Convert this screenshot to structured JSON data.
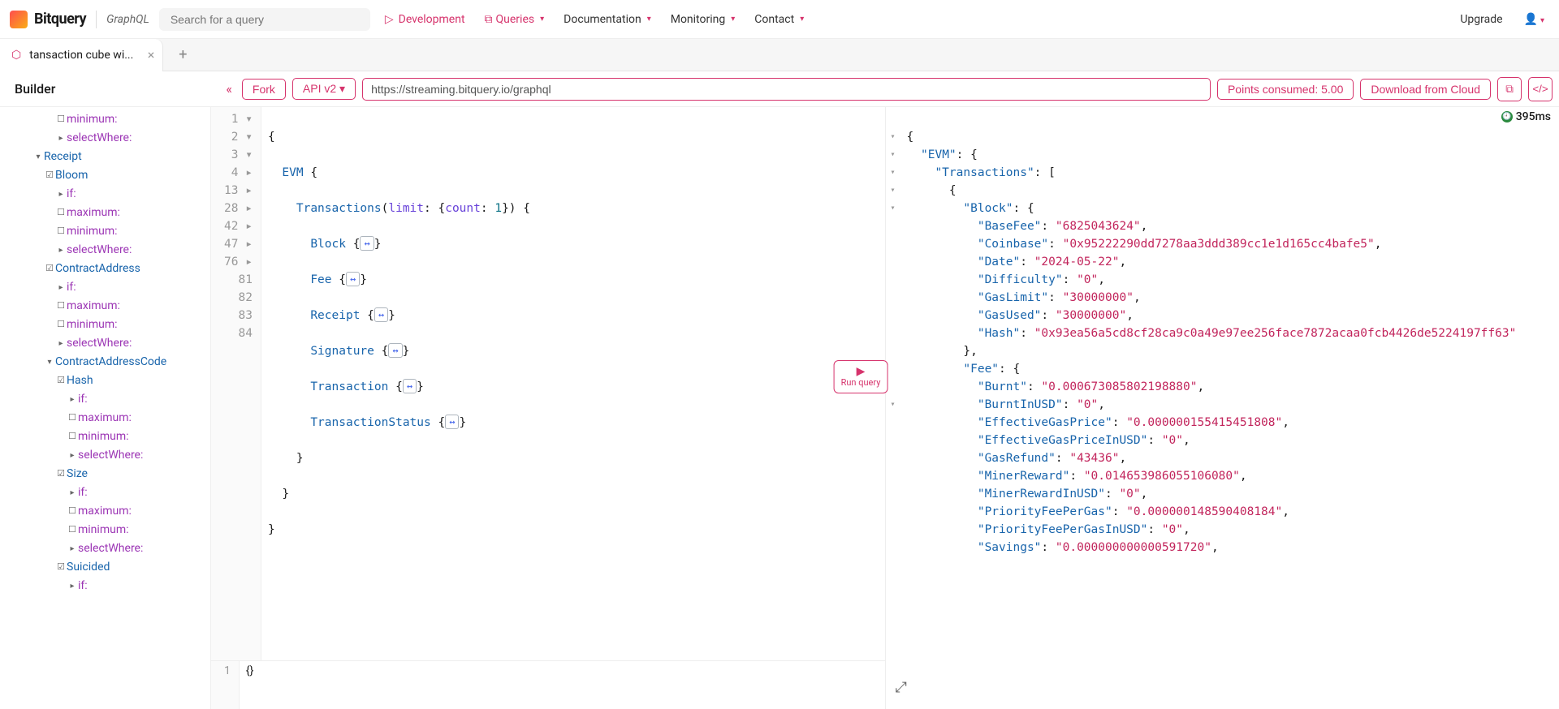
{
  "nav": {
    "brand": "Bitquery",
    "graphql": "GraphQL",
    "search_placeholder": "Search for a query",
    "development": "Development",
    "queries": "Queries",
    "documentation": "Documentation",
    "monitoring": "Monitoring",
    "contact": "Contact",
    "upgrade": "Upgrade"
  },
  "tab": {
    "title": "tansaction cube wi...",
    "close": "×",
    "add": "+"
  },
  "toolbar": {
    "builder": "Builder",
    "collapse": "«",
    "fork": "Fork",
    "api_version": "API v2",
    "url": "https://streaming.bitquery.io/graphql",
    "points": "Points consumed: 5.00",
    "download": "Download from Cloud"
  },
  "sidebar": {
    "minimum": "minimum:",
    "maximum": "maximum:",
    "selectWhere": "selectWhere:",
    "if": "if:",
    "receipt": "Receipt",
    "bloom": "Bloom",
    "contractAddress": "ContractAddress",
    "contractAddressCode": "ContractAddressCode",
    "hash": "Hash",
    "size": "Size",
    "suicided": "Suicided"
  },
  "editor": {
    "gutter": [
      "1",
      "2",
      "3",
      "4",
      "13",
      "28",
      "42",
      "47",
      "76",
      "81",
      "82",
      "83",
      "84"
    ],
    "line1": "{",
    "line2_a": "EVM",
    "line2_b": " {",
    "line3_a": "Transactions",
    "line3_b": "(",
    "line3_c": "limit",
    "line3_d": ": {",
    "line3_e": "count",
    "line3_f": ": ",
    "line3_g": "1",
    "line3_h": "}) {",
    "line4_a": "Block",
    "line4_b": " {",
    "fold": "↔",
    "line4_c": "}",
    "line5_a": "Fee",
    "line6_a": "Receipt",
    "line7_a": "Signature",
    "line8_a": "Transaction",
    "line9_a": "TransactionStatus",
    "line10": "    }",
    "line11": "  }",
    "line12": "}",
    "vars_gutter": "1",
    "vars_body": "{}"
  },
  "results": {
    "timing": "395ms",
    "body_keys": {
      "evm": "\"EVM\"",
      "transactions": "\"Transactions\"",
      "block": "\"Block\"",
      "basefee": "\"BaseFee\"",
      "coinbase": "\"Coinbase\"",
      "date": "\"Date\"",
      "difficulty": "\"Difficulty\"",
      "gaslimit": "\"GasLimit\"",
      "gasused": "\"GasUsed\"",
      "hash": "\"Hash\"",
      "fee": "\"Fee\"",
      "burnt": "\"Burnt\"",
      "burntusd": "\"BurntInUSD\"",
      "effgas": "\"EffectiveGasPrice\"",
      "effgasusd": "\"EffectiveGasPriceInUSD\"",
      "gasrefund": "\"GasRefund\"",
      "minerreward": "\"MinerReward\"",
      "minerrewardusd": "\"MinerRewardInUSD\"",
      "priorityfee": "\"PriorityFeePerGas\"",
      "priorityfeeusd": "\"PriorityFeePerGasInUSD\"",
      "savings": "\"Savings\""
    },
    "vals": {
      "basefee": "\"6825043624\"",
      "coinbase": "\"0x95222290dd7278aa3ddd389cc1e1d165cc4bafe5\"",
      "date": "\"2024-05-22\"",
      "difficulty": "\"0\"",
      "gaslimit": "\"30000000\"",
      "gasused": "\"30000000\"",
      "hash": "\"0x93ea56a5cd8cf28ca9c0a49e97ee256face7872acaa0fcb4426de5224197ff63\"",
      "burnt": "\"0.000673085802198880\"",
      "burntusd": "\"0\"",
      "effgas": "\"0.000000155415451808\"",
      "effgasusd": "\"0\"",
      "gasrefund": "\"43436\"",
      "minerreward": "\"0.014653986055106080\"",
      "minerrewardusd": "\"0\"",
      "priorityfee": "\"0.000000148590408184\"",
      "priorityfeeusd": "\"0\"",
      "savings": "\"0.000000000000591720\""
    }
  },
  "run": {
    "label": "Run query",
    "icon": "▶"
  }
}
